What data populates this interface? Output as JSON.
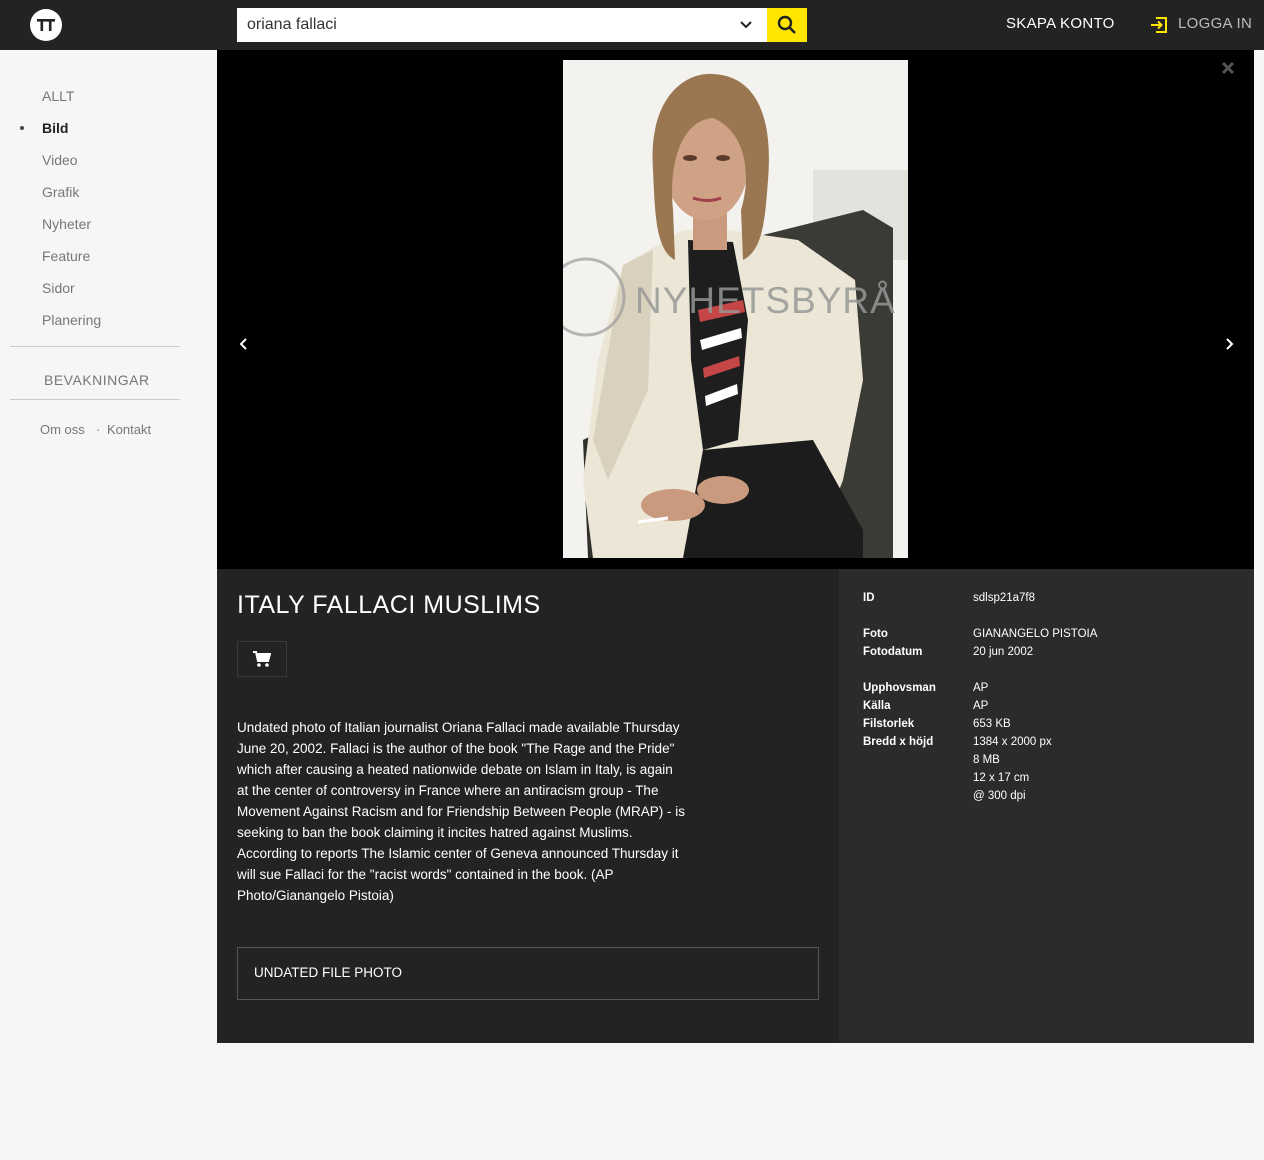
{
  "header": {
    "logo_text": "TT",
    "search_value": "oriana fallaci",
    "create_account": "SKAPA KONTO",
    "login": "LOGGA IN"
  },
  "sidebar": {
    "items": [
      {
        "label": "ALLT",
        "active": false
      },
      {
        "label": "Bild",
        "active": true
      },
      {
        "label": "Video",
        "active": false
      },
      {
        "label": "Grafik",
        "active": false
      },
      {
        "label": "Nyheter",
        "active": false
      },
      {
        "label": "Feature",
        "active": false
      },
      {
        "label": "Sidor",
        "active": false
      },
      {
        "label": "Planering",
        "active": false
      }
    ],
    "watches": "BEVAKNINGAR",
    "about": "Om oss",
    "contact": "Kontakt",
    "separator": "·"
  },
  "viewer": {
    "watermark": "NYHETSBYRÅ"
  },
  "article": {
    "headline": "ITALY FALLACI MUSLIMS",
    "description": "Undated photo of Italian journalist Oriana Fallaci made available Thursday June 20, 2002. Fallaci is the author of the book \"The Rage and the Pride\" which after causing a heated nationwide debate on Islam in Italy, is again at the center of controversy in France where an antiracism group - The Movement Against Racism and for Friendship Between People (MRAP) - is seeking to ban the book claiming it incites hatred against Muslims. According to reports The Islamic center of Geneva announced Thursday it will sue Fallaci for the \"racist words\" contained in the book. (AP Photo/Gianangelo Pistoia)",
    "tag": "UNDATED FILE PHOTO"
  },
  "meta": {
    "id_label": "ID",
    "id_value": "sdlsp21a7f8",
    "foto_label": "Foto",
    "foto_value": "GIANANGELO PISTOIA",
    "fotodatum_label": "Fotodatum",
    "fotodatum_value": "20 jun 2002",
    "upphovsman_label": "Upphovsman",
    "upphovsman_value": "AP",
    "kalla_label": "Källa",
    "kalla_value": "AP",
    "filstorlek_label": "Filstorlek",
    "filstorlek_value": "653 KB",
    "dim_label": "Bredd x höjd",
    "dim_px": "1384 x 2000 px",
    "dim_mb": "8 MB",
    "dim_cm": "12 x 17 cm",
    "dim_dpi": "@ 300 dpi"
  },
  "colors": {
    "topbar": "#232323",
    "accent": "#ffe600",
    "panel_left": "#232323",
    "panel_right": "#2b2b2b"
  }
}
